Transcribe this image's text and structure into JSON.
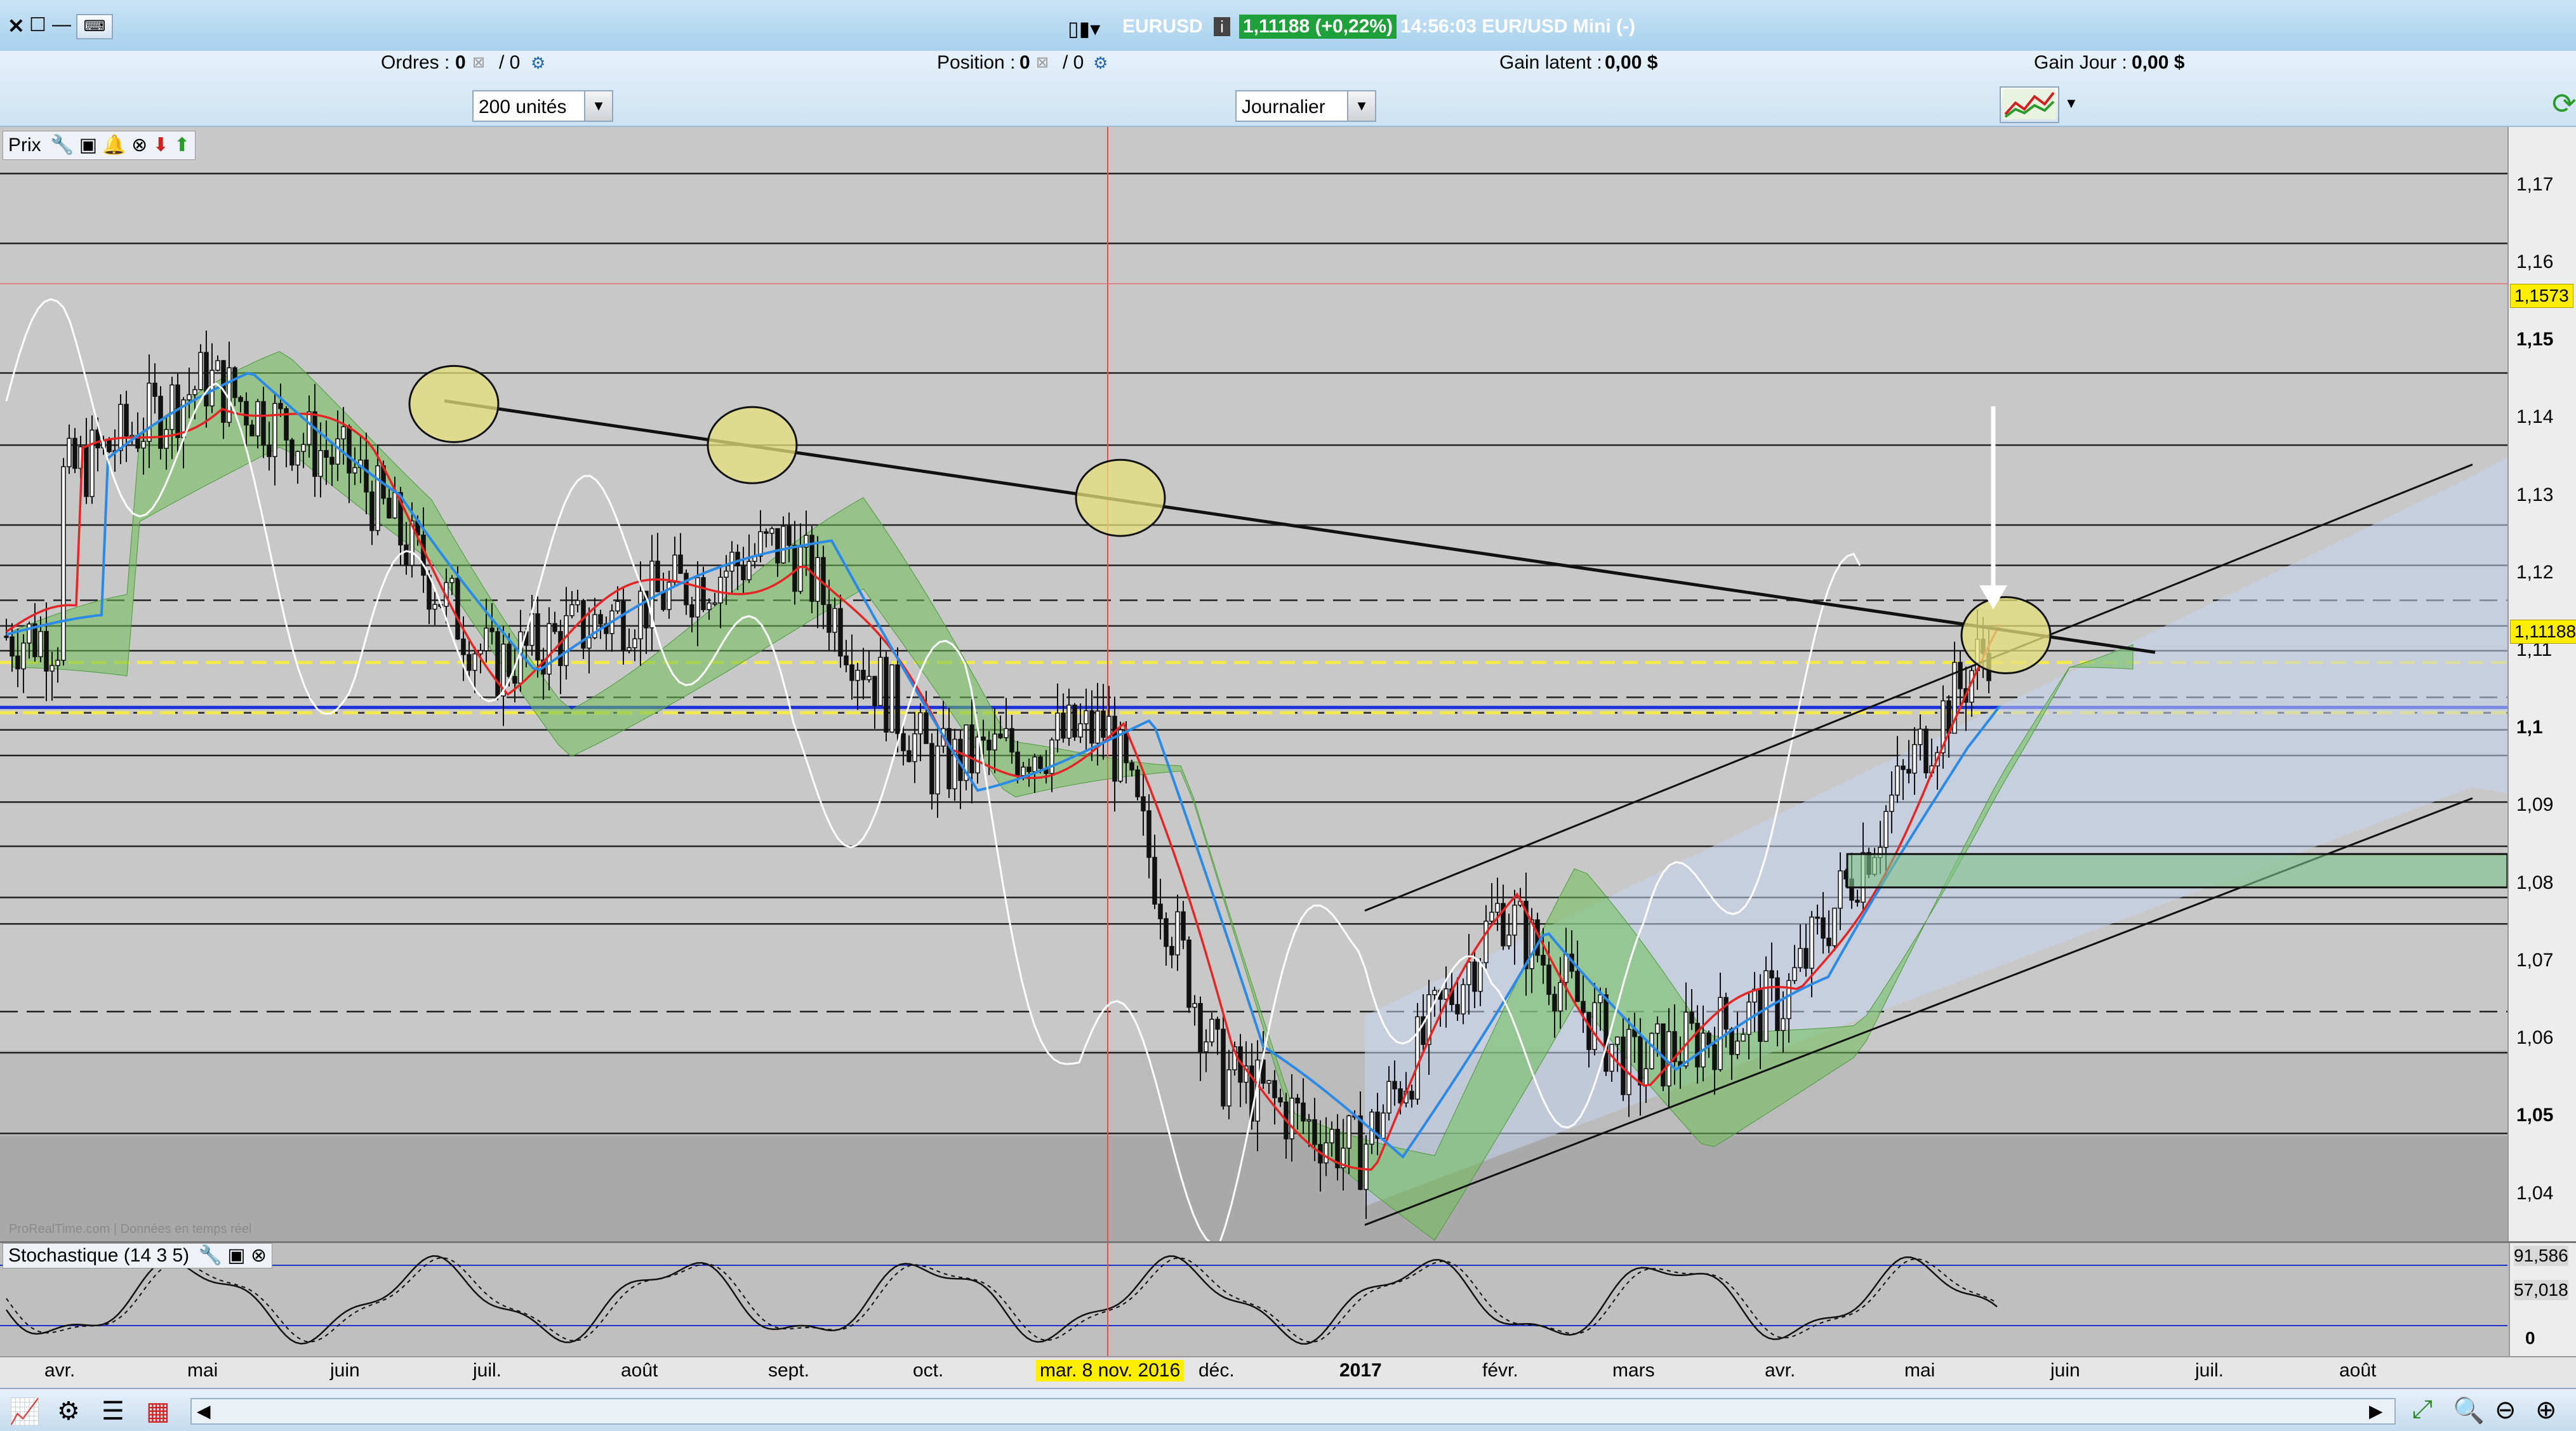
{
  "window": {
    "symbol": "EURUSD",
    "price_badge": "1,11188 (+0,22%)",
    "time_instrument": "14:56:03 EUR/USD Mini (-)"
  },
  "toolbar": {
    "orders_label": "Ordres :",
    "orders_value": "0",
    "orders_value2": "/ 0",
    "position_label": "Position :",
    "position_value": "0",
    "position_value2": "/ 0",
    "gain_latent_label": "Gain latent :",
    "gain_latent_value": "0,00 $",
    "gain_jour_label": "Gain Jour :",
    "gain_jour_value": "0,00 $",
    "units_select": "200 unités",
    "period_select": "Journalier"
  },
  "price_panel": {
    "title": "Prix",
    "watermark": "ProRealTime.com | Données en temps réel",
    "current_price": "1,11188",
    "crosshair_price": "1,1573",
    "crosshair_date": "mar. 8 nov. 2016"
  },
  "stoch_panel": {
    "title": "Stochastique (14 3 5)",
    "value_1": "91,586",
    "value_2": "57,018",
    "value_3": "0"
  },
  "chart_data": {
    "type": "candlestick",
    "instrument": "EURUSD",
    "timeframe": "Journalier",
    "y_axis_ticks": [
      "1,04",
      "1,05",
      "1,06",
      "1,07",
      "1,08",
      "1,09",
      "1,1",
      "1,11",
      "1,12",
      "1,13",
      "1,14",
      "1,15",
      "1,16",
      "1,17"
    ],
    "ylim": [
      1.0335,
      1.1775
    ],
    "x_axis_ticks": [
      "avr.",
      "mai",
      "juin",
      "juil.",
      "août",
      "sept.",
      "oct.",
      "déc.",
      "2017",
      "févr.",
      "mars",
      "avr.",
      "mai",
      "juin",
      "juil.",
      "août"
    ],
    "highlighted_date": "mar. 8 nov. 2016",
    "current_price": 1.11188,
    "crosshair_price": 1.1573,
    "approx_close_path": [
      [
        "avr.",
        1.132
      ],
      [
        "mai",
        1.145
      ],
      [
        "juin",
        1.133
      ],
      [
        "juil.",
        1.108
      ],
      [
        "août",
        1.116
      ],
      [
        "sept.",
        1.124
      ],
      [
        "oct.",
        1.095
      ],
      [
        "mar. 8 nov. 2016",
        1.1
      ],
      [
        "déc.",
        1.056
      ],
      [
        "2017",
        1.045
      ],
      [
        "févr.",
        1.077
      ],
      [
        "mars",
        1.056
      ],
      [
        "avr.",
        1.065
      ],
      [
        "mai",
        1.098
      ],
      [
        "mai (last)",
        1.11188
      ]
    ],
    "stochastic": {
      "period": "14 3 5",
      "upper": 91.586,
      "middle": 57.018,
      "lower": 0
    }
  }
}
